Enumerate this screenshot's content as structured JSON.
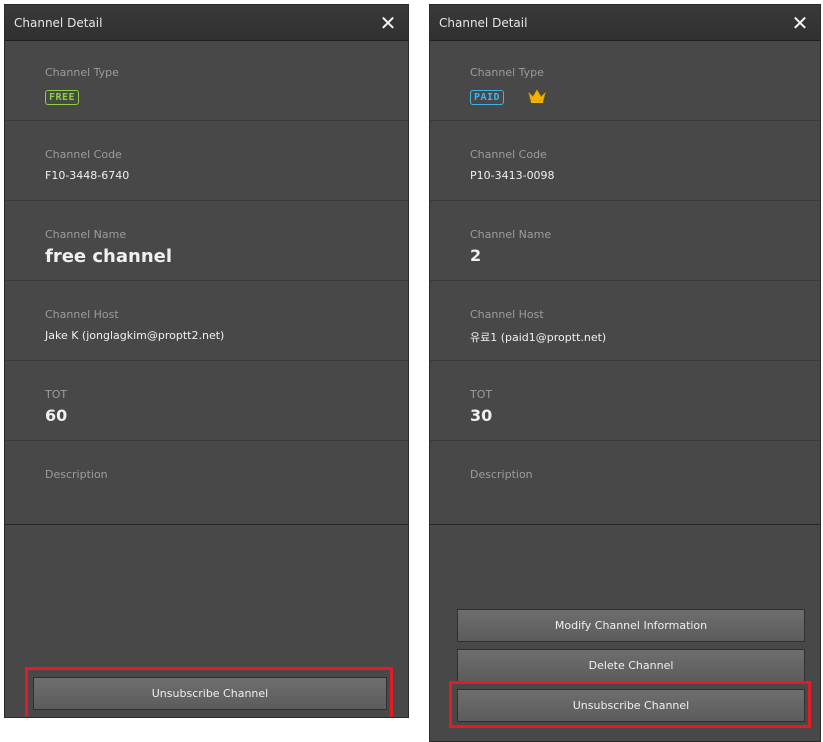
{
  "left": {
    "title": "Channel Detail",
    "close": "✕",
    "channel_type": {
      "label": "Channel Type",
      "badge": "FREE",
      "badge_color": "#8cd23a"
    },
    "channel_code": {
      "label": "Channel Code",
      "value": "F10-3448-6740"
    },
    "channel_name": {
      "label": "Channel Name",
      "value": "free channel"
    },
    "channel_host": {
      "label": "Channel Host",
      "value": "Jake K (jonglagkim@proptt2.net)"
    },
    "tot": {
      "label": "TOT",
      "value": "60"
    },
    "description": {
      "label": "Description",
      "value": ""
    },
    "buttons": {
      "unsubscribe": "Unsubscribe Channel"
    }
  },
  "right": {
    "title": "Channel Detail",
    "close": "✕",
    "channel_type": {
      "label": "Channel Type",
      "badge": "PAID",
      "badge_color": "#3fb4e8",
      "icon": "crown-icon"
    },
    "channel_code": {
      "label": "Channel Code",
      "value": "P10-3413-0098"
    },
    "channel_name": {
      "label": "Channel Name",
      "value": "2"
    },
    "channel_host": {
      "label": "Channel Host",
      "value": "유료1 (paid1@proptt.net)"
    },
    "tot": {
      "label": "TOT",
      "value": "30"
    },
    "description": {
      "label": "Description",
      "value": ""
    },
    "buttons": {
      "modify": "Modify Channel Information",
      "delete": "Delete Channel",
      "unsubscribe": "Unsubscribe Channel"
    }
  },
  "colors": {
    "panel_bg": "#484848",
    "titlebar_bg": "#333333",
    "highlight": "#e51b24",
    "button_bg": "#666666"
  }
}
